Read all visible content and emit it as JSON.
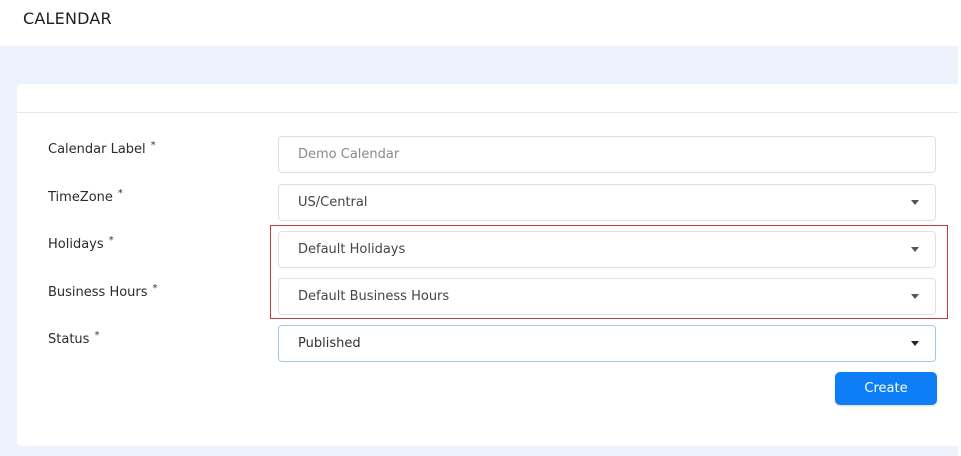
{
  "header": {
    "title": "CALENDAR"
  },
  "form": {
    "required_mark": "*",
    "calendar_label": {
      "label": "Calendar Label",
      "placeholder": "Demo Calendar"
    },
    "timezone": {
      "label": "TimeZone",
      "value": "US/Central"
    },
    "holidays": {
      "label": "Holidays",
      "value": "Default Holidays"
    },
    "business_hours": {
      "label": "Business Hours",
      "value": "Default Business Hours"
    },
    "status": {
      "label": "Status",
      "value": "Published"
    },
    "create_label": "Create"
  },
  "colors": {
    "accent": "#0d7ef5",
    "highlight": "#c73a3a",
    "background": "#edf3fc"
  }
}
